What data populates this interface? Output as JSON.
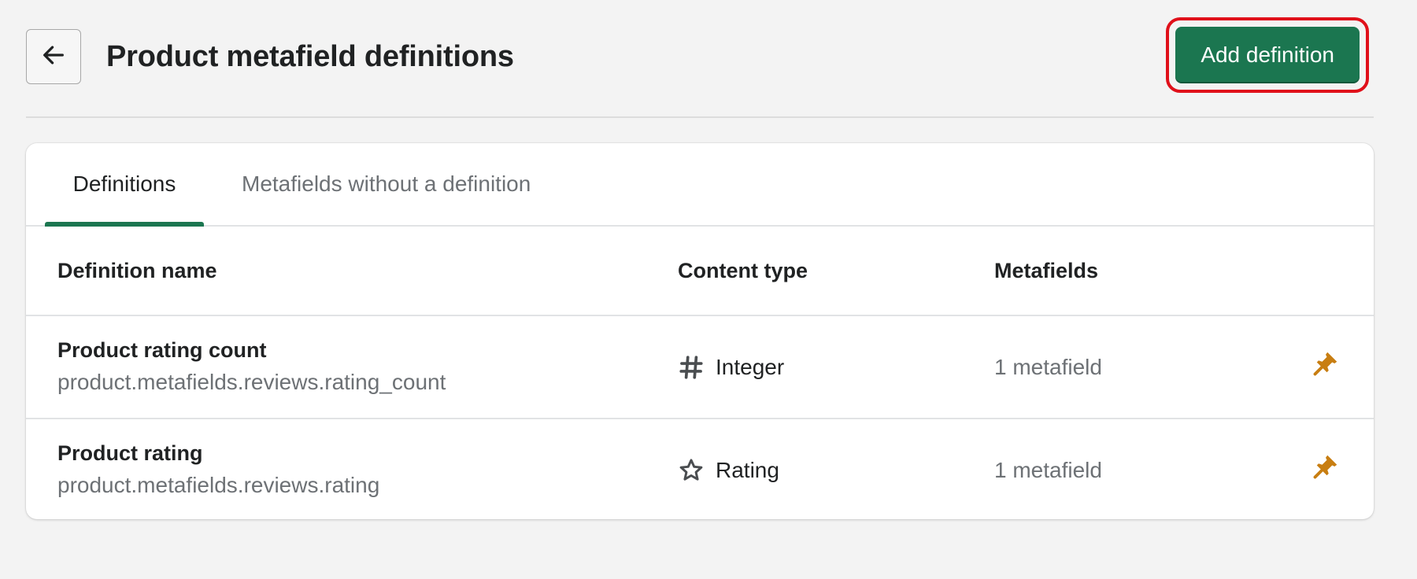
{
  "header": {
    "back_icon": "arrow-left-icon",
    "title": "Product metafield definitions",
    "add_button_label": "Add definition",
    "highlight_color": "#e0101a",
    "accent_color": "#1b7650"
  },
  "tabs": [
    {
      "label": "Definitions",
      "selected": true
    },
    {
      "label": "Metafields without a definition",
      "selected": false
    }
  ],
  "table": {
    "columns": [
      "Definition name",
      "Content type",
      "Metafields"
    ],
    "rows": [
      {
        "name": "Product rating count",
        "key": "product.metafields.reviews.rating_count",
        "type_icon": "hash-icon",
        "type": "Integer",
        "metafields": "1 metafield",
        "pin_icon": "pin-icon",
        "pin_color": "#c87e12"
      },
      {
        "name": "Product rating",
        "key": "product.metafields.reviews.rating",
        "type_icon": "star-icon",
        "type": "Rating",
        "metafields": "1 metafield",
        "pin_icon": "pin-icon",
        "pin_color": "#c87e12"
      }
    ]
  }
}
